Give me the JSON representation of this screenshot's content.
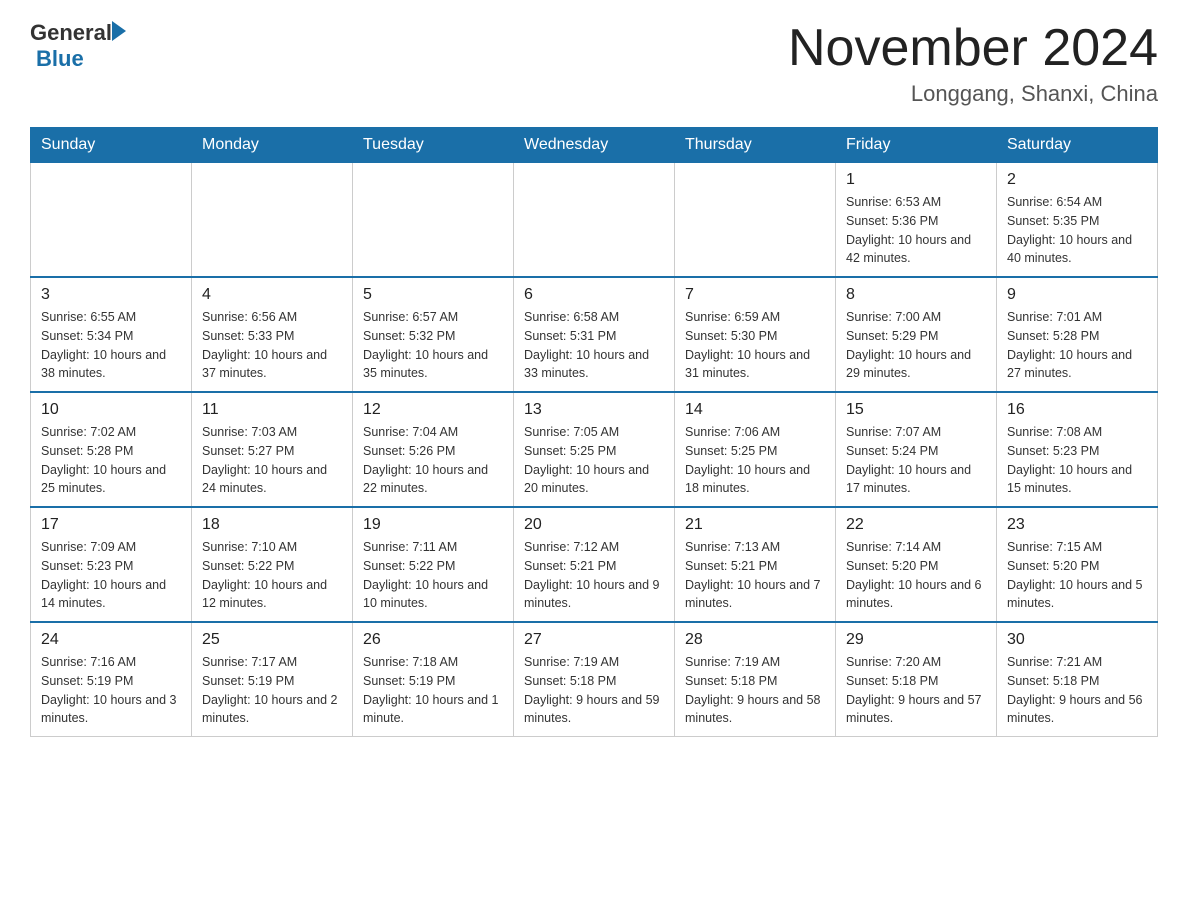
{
  "header": {
    "logo_general": "General",
    "logo_blue": "Blue",
    "month_title": "November 2024",
    "location": "Longgang, Shanxi, China"
  },
  "weekdays": [
    "Sunday",
    "Monday",
    "Tuesday",
    "Wednesday",
    "Thursday",
    "Friday",
    "Saturday"
  ],
  "weeks": [
    {
      "days": [
        {
          "num": "",
          "info": ""
        },
        {
          "num": "",
          "info": ""
        },
        {
          "num": "",
          "info": ""
        },
        {
          "num": "",
          "info": ""
        },
        {
          "num": "",
          "info": ""
        },
        {
          "num": "1",
          "info": "Sunrise: 6:53 AM\nSunset: 5:36 PM\nDaylight: 10 hours and 42 minutes."
        },
        {
          "num": "2",
          "info": "Sunrise: 6:54 AM\nSunset: 5:35 PM\nDaylight: 10 hours and 40 minutes."
        }
      ]
    },
    {
      "days": [
        {
          "num": "3",
          "info": "Sunrise: 6:55 AM\nSunset: 5:34 PM\nDaylight: 10 hours and 38 minutes."
        },
        {
          "num": "4",
          "info": "Sunrise: 6:56 AM\nSunset: 5:33 PM\nDaylight: 10 hours and 37 minutes."
        },
        {
          "num": "5",
          "info": "Sunrise: 6:57 AM\nSunset: 5:32 PM\nDaylight: 10 hours and 35 minutes."
        },
        {
          "num": "6",
          "info": "Sunrise: 6:58 AM\nSunset: 5:31 PM\nDaylight: 10 hours and 33 minutes."
        },
        {
          "num": "7",
          "info": "Sunrise: 6:59 AM\nSunset: 5:30 PM\nDaylight: 10 hours and 31 minutes."
        },
        {
          "num": "8",
          "info": "Sunrise: 7:00 AM\nSunset: 5:29 PM\nDaylight: 10 hours and 29 minutes."
        },
        {
          "num": "9",
          "info": "Sunrise: 7:01 AM\nSunset: 5:28 PM\nDaylight: 10 hours and 27 minutes."
        }
      ]
    },
    {
      "days": [
        {
          "num": "10",
          "info": "Sunrise: 7:02 AM\nSunset: 5:28 PM\nDaylight: 10 hours and 25 minutes."
        },
        {
          "num": "11",
          "info": "Sunrise: 7:03 AM\nSunset: 5:27 PM\nDaylight: 10 hours and 24 minutes."
        },
        {
          "num": "12",
          "info": "Sunrise: 7:04 AM\nSunset: 5:26 PM\nDaylight: 10 hours and 22 minutes."
        },
        {
          "num": "13",
          "info": "Sunrise: 7:05 AM\nSunset: 5:25 PM\nDaylight: 10 hours and 20 minutes."
        },
        {
          "num": "14",
          "info": "Sunrise: 7:06 AM\nSunset: 5:25 PM\nDaylight: 10 hours and 18 minutes."
        },
        {
          "num": "15",
          "info": "Sunrise: 7:07 AM\nSunset: 5:24 PM\nDaylight: 10 hours and 17 minutes."
        },
        {
          "num": "16",
          "info": "Sunrise: 7:08 AM\nSunset: 5:23 PM\nDaylight: 10 hours and 15 minutes."
        }
      ]
    },
    {
      "days": [
        {
          "num": "17",
          "info": "Sunrise: 7:09 AM\nSunset: 5:23 PM\nDaylight: 10 hours and 14 minutes."
        },
        {
          "num": "18",
          "info": "Sunrise: 7:10 AM\nSunset: 5:22 PM\nDaylight: 10 hours and 12 minutes."
        },
        {
          "num": "19",
          "info": "Sunrise: 7:11 AM\nSunset: 5:22 PM\nDaylight: 10 hours and 10 minutes."
        },
        {
          "num": "20",
          "info": "Sunrise: 7:12 AM\nSunset: 5:21 PM\nDaylight: 10 hours and 9 minutes."
        },
        {
          "num": "21",
          "info": "Sunrise: 7:13 AM\nSunset: 5:21 PM\nDaylight: 10 hours and 7 minutes."
        },
        {
          "num": "22",
          "info": "Sunrise: 7:14 AM\nSunset: 5:20 PM\nDaylight: 10 hours and 6 minutes."
        },
        {
          "num": "23",
          "info": "Sunrise: 7:15 AM\nSunset: 5:20 PM\nDaylight: 10 hours and 5 minutes."
        }
      ]
    },
    {
      "days": [
        {
          "num": "24",
          "info": "Sunrise: 7:16 AM\nSunset: 5:19 PM\nDaylight: 10 hours and 3 minutes."
        },
        {
          "num": "25",
          "info": "Sunrise: 7:17 AM\nSunset: 5:19 PM\nDaylight: 10 hours and 2 minutes."
        },
        {
          "num": "26",
          "info": "Sunrise: 7:18 AM\nSunset: 5:19 PM\nDaylight: 10 hours and 1 minute."
        },
        {
          "num": "27",
          "info": "Sunrise: 7:19 AM\nSunset: 5:18 PM\nDaylight: 9 hours and 59 minutes."
        },
        {
          "num": "28",
          "info": "Sunrise: 7:19 AM\nSunset: 5:18 PM\nDaylight: 9 hours and 58 minutes."
        },
        {
          "num": "29",
          "info": "Sunrise: 7:20 AM\nSunset: 5:18 PM\nDaylight: 9 hours and 57 minutes."
        },
        {
          "num": "30",
          "info": "Sunrise: 7:21 AM\nSunset: 5:18 PM\nDaylight: 9 hours and 56 minutes."
        }
      ]
    }
  ]
}
